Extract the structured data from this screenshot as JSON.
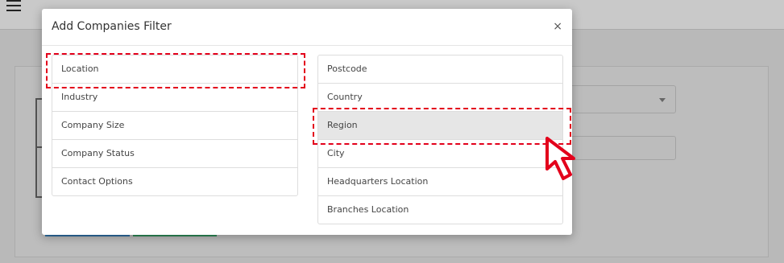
{
  "modal": {
    "title": "Add Companies Filter",
    "close_label": "×"
  },
  "left_filters": [
    "Location",
    "Industry",
    "Company Size",
    "Company Status",
    "Contact Options"
  ],
  "right_filters": [
    "Postcode",
    "Country",
    "Region",
    "City",
    "Headquarters Location",
    "Branches Location"
  ],
  "selected": "Region",
  "highlighted": [
    "Location",
    "Region"
  ],
  "colors": {
    "highlight": "#e3001b",
    "overlay": "#b9b9b9",
    "selected_bg": "#e6e6e6"
  },
  "icons": {
    "menu": "hamburger-menu-icon",
    "pointer": "mouse-pointer-icon"
  }
}
